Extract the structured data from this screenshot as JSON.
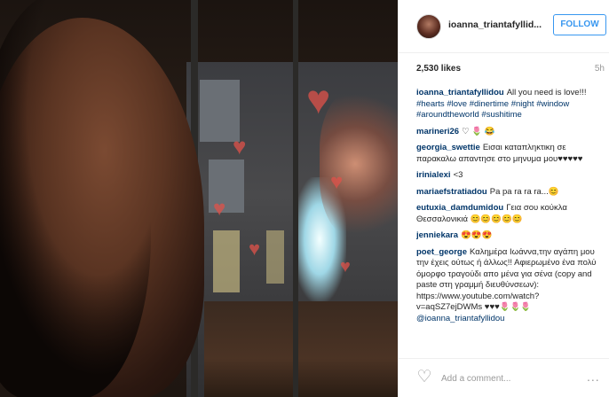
{
  "photo": {
    "alt_icon": "photo-image"
  },
  "header": {
    "username": "ioanna_triantafyllid...",
    "follow_label": "FOLLOW"
  },
  "stats": {
    "likes": "2,530 likes",
    "time": "5h"
  },
  "comments": [
    {
      "user": "ioanna_triantafyllidou",
      "segments": [
        {
          "t": "All you need is love!!! "
        },
        {
          "t": "#hearts",
          "tag": true
        },
        {
          "t": " "
        },
        {
          "t": "#love",
          "tag": true
        },
        {
          "t": " "
        },
        {
          "t": "#dinertime",
          "tag": true
        },
        {
          "t": " "
        },
        {
          "t": "#night",
          "tag": true
        },
        {
          "t": " "
        },
        {
          "t": "#window",
          "tag": true
        },
        {
          "t": " "
        },
        {
          "t": "#aroundtheworld",
          "tag": true
        },
        {
          "t": " "
        },
        {
          "t": "#sushitime",
          "tag": true
        }
      ]
    },
    {
      "user": "marineri26",
      "segments": [
        {
          "t": "♡ 🌷 😂"
        }
      ]
    },
    {
      "user": "georgia_swettie",
      "segments": [
        {
          "t": "Εισαι καταπληκτικη σε παρακαλω απαντησε στο μηνυμα μου♥♥♥♥♥"
        }
      ]
    },
    {
      "user": "irinialexi",
      "segments": [
        {
          "t": "<3"
        }
      ]
    },
    {
      "user": "mariaefstratiadou",
      "segments": [
        {
          "t": "Pa pa ra ra ra...😊"
        }
      ]
    },
    {
      "user": "eutuxia_damdumidou",
      "segments": [
        {
          "t": "Γεια σου κούκλα Θεσσαλονικιά 😊😊😊😊😊"
        }
      ]
    },
    {
      "user": "jenniekara",
      "segments": [
        {
          "t": "😍😍😍"
        }
      ]
    },
    {
      "user": "poet_george",
      "segments": [
        {
          "t": "Καλημέρα Ιωάννα,την αγάπη μου την έχεις ούτως ή άλλως!! Αφιερωμένο ένα πολύ όμορφο τραγούδι απο μένα για σένα (copy and paste στη γραμμή διευθύνσεων): https://www.youtube.com/watch?v=aqSZ7ejDWMs ♥♥♥🌷🌷🌷 "
        },
        {
          "t": "@ioanna_triantafyllidou",
          "tag": true
        }
      ]
    }
  ],
  "add_comment": {
    "placeholder": "Add a comment...",
    "more_label": "..."
  },
  "colors": {
    "link": "#003569",
    "follow": "#3897f0"
  }
}
